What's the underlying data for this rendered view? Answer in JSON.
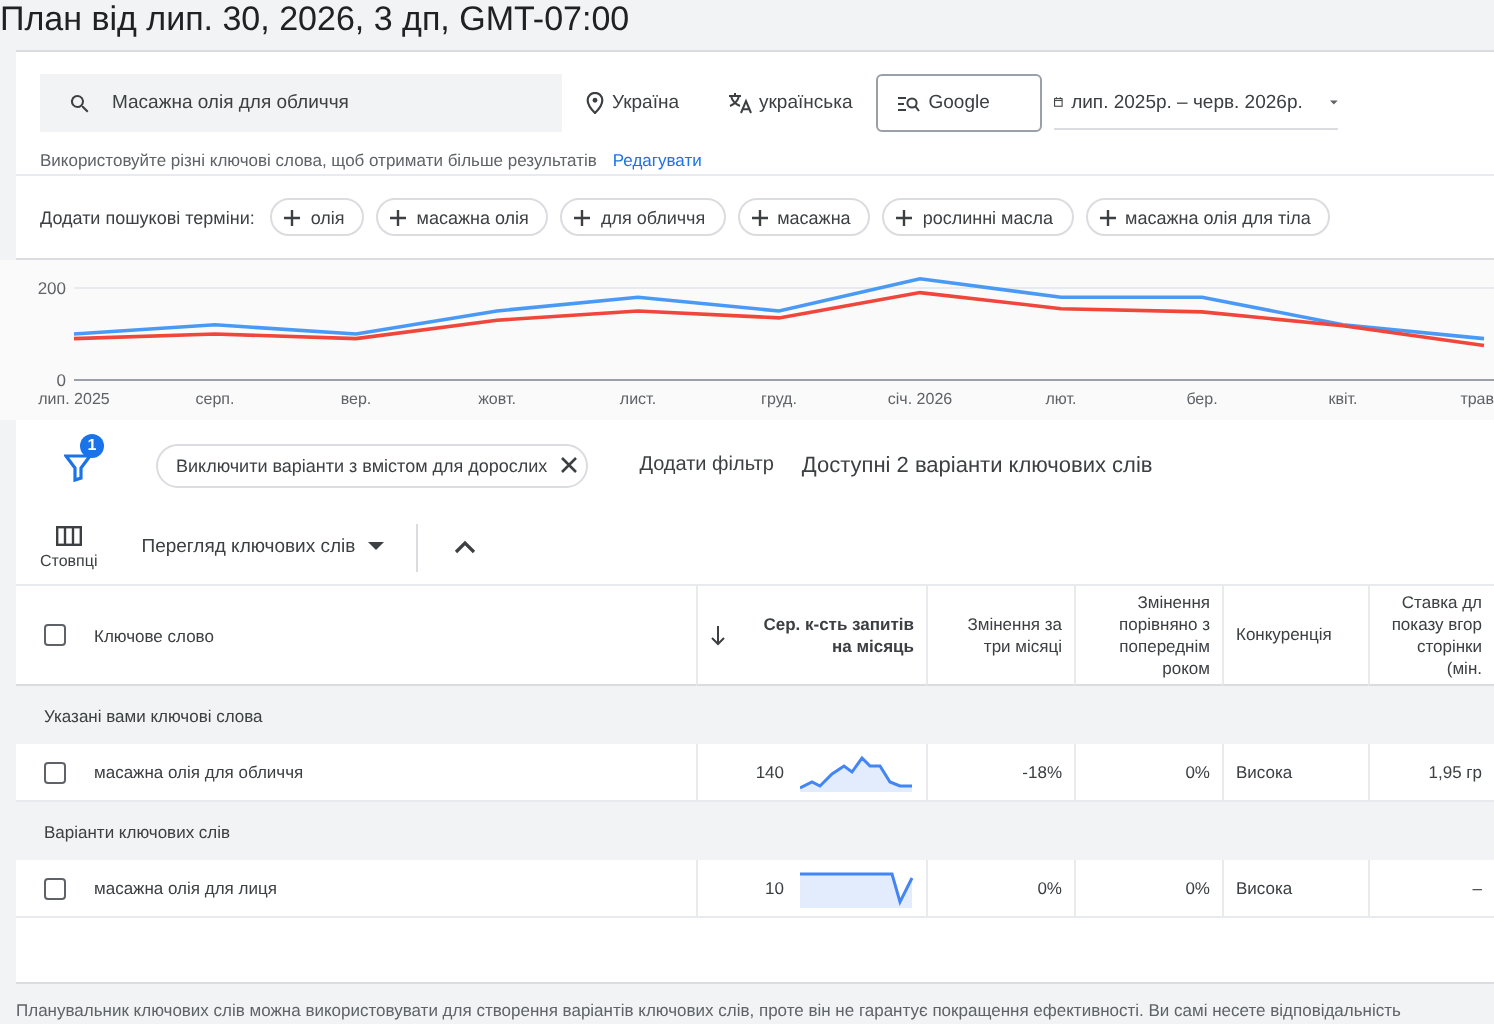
{
  "title": "План від лип. 30, 2026, 3 дп, GMT-07:00",
  "search": {
    "value": "Масажна олія для обличчя",
    "location": "Україна",
    "language": "українська",
    "network": "Google",
    "date_range": "лип. 2025р. – черв. 2026р."
  },
  "hint": {
    "text": "Використовуйте різні ключові слова, щоб отримати більше результатів",
    "link": "Редагувати"
  },
  "suggestions": {
    "label": "Додати пошукові терміни:",
    "chips": [
      "олія",
      "масажна олія",
      "для обличчя",
      "масажна",
      "рослинні масла",
      "масажна олія для тіла"
    ]
  },
  "chart_data": {
    "type": "line",
    "categories": [
      "лип. 2025",
      "серп.",
      "вер.",
      "жовт.",
      "лист.",
      "груд.",
      "січ. 2026",
      "лют.",
      "бер.",
      "квіт.",
      "трав"
    ],
    "yticks": [
      0,
      200
    ],
    "ylim": [
      0,
      250
    ],
    "series": [
      {
        "color": "#4a9af5",
        "values": [
          100,
          120,
          100,
          150,
          180,
          150,
          220,
          180,
          180,
          120,
          90
        ]
      },
      {
        "color": "#f0463c",
        "values": [
          90,
          100,
          90,
          130,
          150,
          135,
          190,
          155,
          148,
          118,
          75
        ]
      }
    ]
  },
  "filters": {
    "badge": "1",
    "chip": "Виключити варіанти з вмістом для дорослих",
    "add": "Додати фільтр",
    "summary": "Доступні 2 варіанти ключових слів"
  },
  "toolbar": {
    "columns": "Стовпці",
    "view": "Перегляд ключових слів"
  },
  "table": {
    "select_all_checked": false,
    "columns": [
      "Ключове слово",
      "Сер. к-сть запитів на місяць",
      "Змінення за три місяці",
      "Змінення порівняно з попереднім роком",
      "Конкуренція",
      "Ставка дл показу вгор сторінки (мін."
    ],
    "groups": [
      {
        "title": "Указані вами ключові слова",
        "rows": [
          {
            "checked": false,
            "keyword": "масажна олія для обличчя",
            "searches": "140",
            "change_3m": "-18%",
            "change_yoy": "0%",
            "competition": "Висока",
            "bid": "1,95 гр"
          }
        ]
      },
      {
        "title": "Варіанти ключових слів",
        "rows": [
          {
            "checked": false,
            "keyword": "масажна олія для лиця",
            "searches": "10",
            "change_3m": "0%",
            "change_yoy": "0%",
            "competition": "Висока",
            "bid": "–"
          }
        ]
      }
    ]
  },
  "footer": "Планувальник ключових слів можна використовувати для створення варіантів ключових слів, проте він не гарантує покращення ефективності. Ви самі несете відповідальність"
}
